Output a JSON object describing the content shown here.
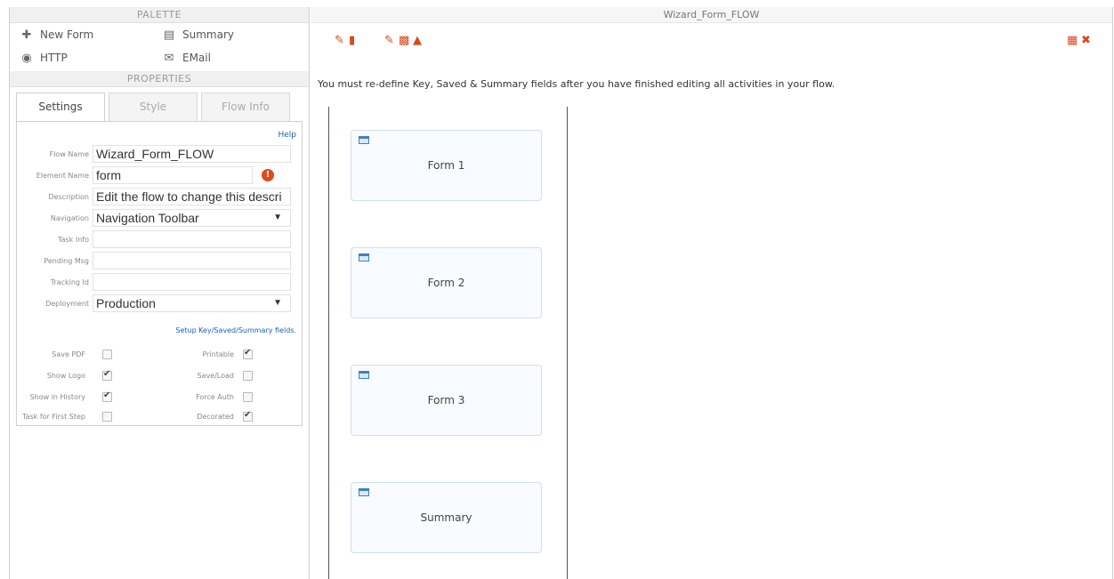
{
  "palette": {
    "header": "PALETTE",
    "items": [
      {
        "label": "New Form",
        "icon": "plus-icon"
      },
      {
        "label": "Summary",
        "icon": "list-icon"
      },
      {
        "label": "HTTP",
        "icon": "globe-icon"
      },
      {
        "label": "EMail",
        "icon": "envelope-icon"
      }
    ]
  },
  "properties": {
    "header": "PROPERTIES",
    "tabs": [
      "Settings",
      "Style",
      "Flow Info"
    ],
    "active_tab": "Settings",
    "help_label": "Help",
    "fields": {
      "flow_name": {
        "label": "Flow Name",
        "value": "Wizard_Form_FLOW"
      },
      "element_name": {
        "label": "Element Name",
        "value": "form"
      },
      "description": {
        "label": "Description",
        "value": "Edit the flow to change this descri"
      },
      "navigation": {
        "label": "Navigation",
        "value": "Navigation Toolbar"
      },
      "task_info": {
        "label": "Task Info",
        "value": ""
      },
      "pending_msg": {
        "label": "Pending Msg",
        "value": ""
      },
      "tracking_id": {
        "label": "Tracking Id",
        "value": ""
      },
      "deployment": {
        "label": "Deployment",
        "value": "Production"
      }
    },
    "setup_link": "Setup Key/Saved/Summary fields.",
    "checkboxes": [
      {
        "label": "Save PDF",
        "checked": false
      },
      {
        "label": "Printable",
        "checked": true
      },
      {
        "label": "Show Logo",
        "checked": true
      },
      {
        "label": "Save/Load",
        "checked": false
      },
      {
        "label": "Show in History",
        "checked": true
      },
      {
        "label": "Force Auth",
        "checked": false
      },
      {
        "label": "Task for First Step",
        "checked": false
      },
      {
        "label": "Decorated",
        "checked": true
      }
    ]
  },
  "canvas": {
    "title": "Wizard_Form_FLOW",
    "notice": "You must re-define Key, Saved & Summary fields after you have finished editing all activities in your flow.",
    "nodes": [
      {
        "label": "Form 1",
        "icon": "form-icon"
      },
      {
        "label": "Form 2",
        "icon": "form-icon"
      },
      {
        "label": "Form 3",
        "icon": "form-icon"
      },
      {
        "label": "Summary",
        "icon": "summary-icon"
      }
    ]
  },
  "colors": {
    "accent": "#d9481a",
    "link": "#1a5fb4",
    "node_border": "#cfe0f0"
  }
}
